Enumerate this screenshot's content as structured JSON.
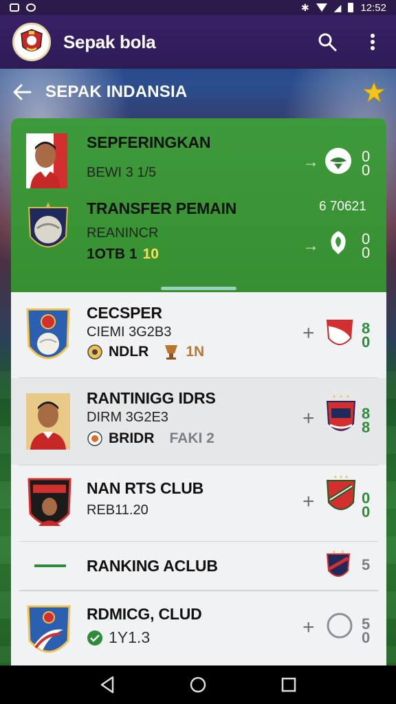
{
  "status_bar": {
    "time": "12:52"
  },
  "app_bar": {
    "title": "Sepak bola"
  },
  "sub_header": {
    "title": "SEPAK INDANSIA"
  },
  "featured": [
    {
      "title": "SEPFERINGKAN",
      "line1": "BEWI 3 1/5",
      "scores": [
        "0",
        "0"
      ]
    },
    {
      "title": "TRANSFER PEMAIN",
      "line1": "REANINCR",
      "line2_a": "1OTB 1",
      "line2_b": "10",
      "tag": "6 70621",
      "scores": [
        "0",
        "0"
      ]
    }
  ],
  "list": [
    {
      "title": "CECSPER",
      "line1": "CIEMI 3G2B3",
      "line2_a": "NDLR",
      "line2_b": "1N",
      "scores": [
        "8",
        "0"
      ]
    },
    {
      "title": "RANTINIGG IDRS",
      "line1": "DIRM 3G2E3",
      "line2_a": "BRIDR",
      "line2_b": "FAKI 2",
      "scores": [
        "8",
        "8"
      ]
    },
    {
      "title": "NAN RTS CLUB",
      "line1": "REB11.20",
      "scores": [
        "0",
        "0"
      ]
    },
    {
      "title": "RANKING ACLUB",
      "scores": [
        "5"
      ]
    },
    {
      "title": "RDMICG, CLUD",
      "line1": "1Y1.3",
      "scores": [
        "5",
        "0"
      ]
    }
  ],
  "colors": {
    "accent_green": "#3d9a3a",
    "score_green": "#2e8b3a",
    "app_bar": "#3a2166"
  }
}
